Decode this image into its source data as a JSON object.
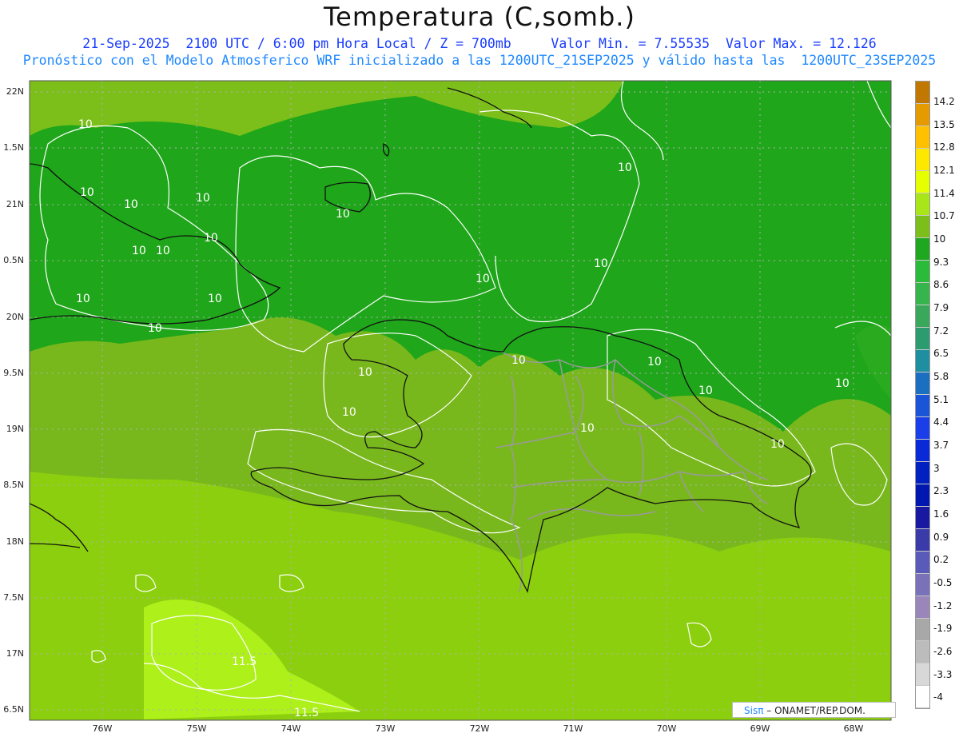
{
  "header": {
    "title": "Temperatura (C,somb.)",
    "line1": "21-Sep-2025  2100 UTC / 6:00 pm Hora Local / Z = 700mb     Valor Min. = 7.55535  Valor Max. = 12.126",
    "line2": "Pronóstico con el Modelo Atmosferico WRF inicializado a las 1200UTC_21SEP2025 y válido hasta las  1200UTC_23SEP2025"
  },
  "axes": {
    "lat_labels": [
      "22N",
      "1.5N",
      "21N",
      "0.5N",
      "20N",
      "9.5N",
      "19N",
      "8.5N",
      "18N",
      "7.5N",
      "17N",
      "6.5N"
    ],
    "lon_labels": [
      "76W",
      "75W",
      "74W",
      "73W",
      "72W",
      "71W",
      "70W",
      "69W",
      "68W"
    ]
  },
  "colorbar": {
    "labels": [
      "14.2",
      "13.5",
      "12.8",
      "12.1",
      "11.4",
      "10.7",
      "10",
      "9.3",
      "8.6",
      "7.9",
      "7.2",
      "6.5",
      "5.8",
      "5.1",
      "4.4",
      "3.7",
      "3",
      "2.3",
      "1.6",
      "0.9",
      "0.2",
      "-0.5",
      "-1.2",
      "-1.9",
      "-2.6",
      "-3.3",
      "-4"
    ],
    "colors": [
      "#c07800",
      "#e59a00",
      "#ffc000",
      "#ffe800",
      "#e6ff00",
      "#a8e61a",
      "#7cbf1a",
      "#1fa81f",
      "#2bbb3a",
      "#35b54b",
      "#3aa85a",
      "#2c9c70",
      "#1e8fa0",
      "#1a6fc0",
      "#1a55d8",
      "#1a3fe8",
      "#0a2ad8",
      "#0020c0",
      "#0018b0",
      "#1818a0",
      "#3a3aa8",
      "#5a5ab8",
      "#7a72b8",
      "#9a86b8",
      "#a8a8a8",
      "#bcbcbc",
      "#d8d8d8",
      "#ffffff"
    ]
  },
  "contours": {
    "labels": [
      "10",
      "10",
      "10",
      "10",
      "10",
      "10",
      "10",
      "10",
      "10",
      "10",
      "10",
      "10",
      "10",
      "10",
      "10",
      "10",
      "10",
      "10",
      "10",
      "10",
      "10",
      "10",
      "11.5",
      "11.5"
    ]
  },
  "credit": {
    "brand": "Sisπ",
    "org": "– ONAMET/REP.DOM."
  }
}
